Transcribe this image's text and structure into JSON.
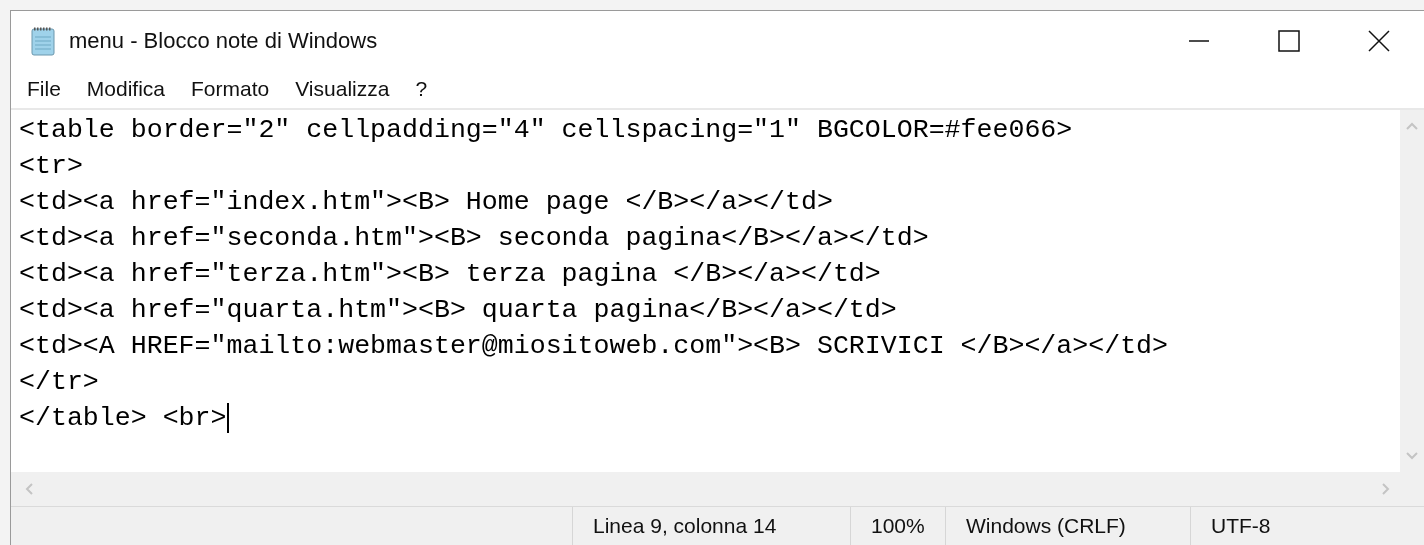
{
  "window": {
    "title": "menu - Blocco note di Windows"
  },
  "menu": [
    "File",
    "Modifica",
    "Formato",
    "Visualizza",
    "?"
  ],
  "editor": {
    "lines": [
      "<table border=\"2\" cellpadding=\"4\" cellspacing=\"1\" BGCOLOR=#fee066>",
      "<tr>",
      "<td><a href=\"index.htm\"><B> Home page </B></a></td>",
      "<td><a href=\"seconda.htm\"><B> seconda pagina</B></a></td>",
      "<td><a href=\"terza.htm\"><B> terza pagina </B></a></td>",
      "<td><a href=\"quarta.htm\"><B> quarta pagina</B></a></td>",
      "<td><A HREF=\"mailto:webmaster@miositoweb.com\"><B> SCRIVICI </B></a></td>",
      "</tr>",
      "</table> <br>"
    ]
  },
  "status_bar": [
    "Linea 9, colonna 14",
    "100%",
    "Windows (CRLF)",
    "UTF-8"
  ]
}
